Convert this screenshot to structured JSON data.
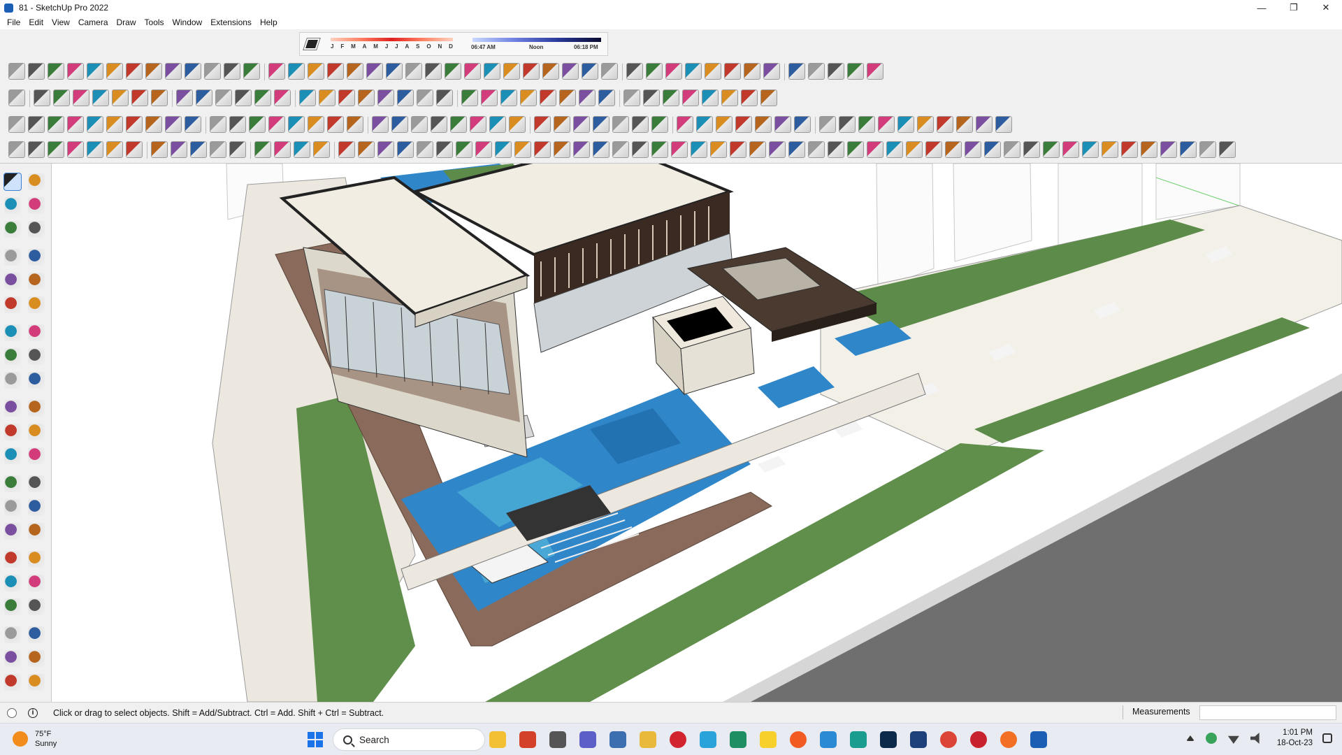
{
  "window": {
    "title": "81 - SketchUp Pro 2022",
    "minimize_glyph": "—",
    "maximize_glyph": "❐",
    "close_glyph": "✕"
  },
  "menu": [
    "File",
    "Edit",
    "View",
    "Camera",
    "Draw",
    "Tools",
    "Window",
    "Extensions",
    "Help"
  ],
  "shadows": {
    "months": [
      "J",
      "F",
      "M",
      "A",
      "M",
      "J",
      "J",
      "A",
      "S",
      "O",
      "N",
      "D"
    ],
    "time_start": "06:47 AM",
    "time_mid": "Noon",
    "time_end": "06:18 PM"
  },
  "status": {
    "hint": "Click or drag to select objects. Shift = Add/Subtract. Ctrl = Add. Shift + Ctrl = Subtract.",
    "info_glyph": "i",
    "measurements_label": "Measurements",
    "measurements_value": ""
  },
  "taskbar": {
    "weather_temp": "75°F",
    "weather_desc": "Sunny",
    "search_label": "Search",
    "time": "1:01 PM",
    "date": "18-Oct-23"
  },
  "colors": {
    "accent": "#1a73e8",
    "selection": "#cfe2fb",
    "water": "#2f86c8",
    "grass": "#5d8b4a",
    "deck": "#8a6a5a",
    "roof": "#f2ede2"
  }
}
